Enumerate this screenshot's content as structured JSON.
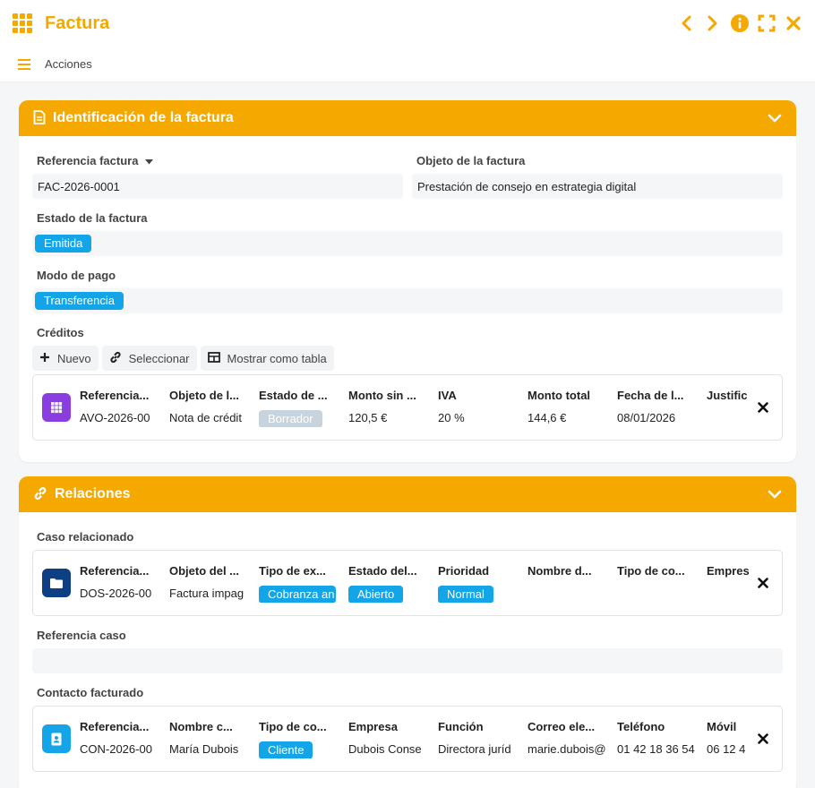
{
  "window": {
    "title": "Factura"
  },
  "actions": {
    "label": "Acciones"
  },
  "colors": {
    "accent": "#f5a800",
    "tag": "#14a5e8",
    "tag_draft": "#c7d4de"
  },
  "identification": {
    "title": "Identificación de la factura",
    "ref_label": "Referencia factura",
    "ref_value": "FAC-2026-0001",
    "object_label": "Objeto de la factura",
    "object_value": "Prestación de consejo en estrategia digital",
    "state_label": "Estado de la factura",
    "state_value": "Emitida",
    "pay_label": "Modo de pago",
    "pay_value": "Transferencia",
    "credits_label": "Créditos",
    "btn_new": "Nuevo",
    "btn_select": "Seleccionar",
    "btn_table": "Mostrar como tabla",
    "credit_card": {
      "icon": "grid-icon",
      "icon_color": "#8a3ee0",
      "headers": [
        "Referencia...",
        "Objeto de l...",
        "Estado de ...",
        "Monto sin ...",
        "IVA",
        "Monto total",
        "Fecha de l...",
        "Justific"
      ],
      "values": [
        "AVO-2026-00",
        "Nota de crédit",
        "Borrador",
        "120,5 €",
        "20 %",
        "144,6 €",
        "08/01/2026",
        ""
      ]
    }
  },
  "relations": {
    "title": "Relaciones",
    "case_label": "Caso relacionado",
    "case_card": {
      "icon": "folder-icon",
      "icon_color": "#0d3f82",
      "headers": [
        "Referencia...",
        "Objeto del ...",
        "Tipo de ex...",
        "Estado del...",
        "Prioridad",
        "Nombre d...",
        "Tipo de co...",
        "Empres"
      ],
      "values": [
        "DOS-2026-00",
        "Factura impag",
        "Cobranza an",
        "Abierto",
        "Normal",
        "",
        "",
        ""
      ]
    },
    "case_ref_label": "Referencia caso",
    "case_ref_value": "",
    "contact_label": "Contacto facturado",
    "contact_card": {
      "icon": "contact-icon",
      "icon_color": "#14a5e8",
      "headers": [
        "Referencia...",
        "Nombre c...",
        "Tipo de co...",
        "Empresa",
        "Función",
        "Correo ele...",
        "Teléfono",
        "Móvil"
      ],
      "values": [
        "CON-2026-00",
        "María Dubois",
        "Cliente",
        "Dubois Conse",
        "Directora juríd",
        "marie.dubois@",
        "01 42 18 36 54",
        "06 12 4"
      ]
    }
  }
}
